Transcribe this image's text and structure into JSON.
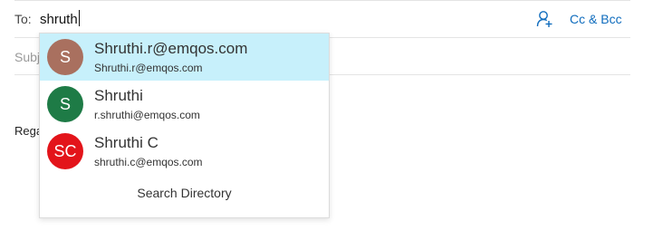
{
  "compose": {
    "to_label": "To:",
    "to_value": "shruth",
    "cc_bcc_label": "Cc & Bcc",
    "subject_placeholder": "Subj",
    "body_fragment": "Rega",
    "icons": {
      "add_recipient": "person-add-icon"
    }
  },
  "suggestions": {
    "items": [
      {
        "initials": "S",
        "name": "Shruthi.r@emqos.com",
        "email": "Shruthi.r@emqos.com",
        "avatar_color": "#a9705f",
        "selected": true
      },
      {
        "initials": "S",
        "name": "Shruthi",
        "email": "r.shruthi@emqos.com",
        "avatar_color": "#1e7b46",
        "selected": false
      },
      {
        "initials": "SC",
        "name": "Shruthi C",
        "email": "shruthi.c@emqos.com",
        "avatar_color": "#e3141a",
        "selected": false
      }
    ],
    "search_directory_label": "Search Directory"
  },
  "colors": {
    "accent": "#0f6cbd",
    "selected_bg": "#c7f0fb"
  }
}
